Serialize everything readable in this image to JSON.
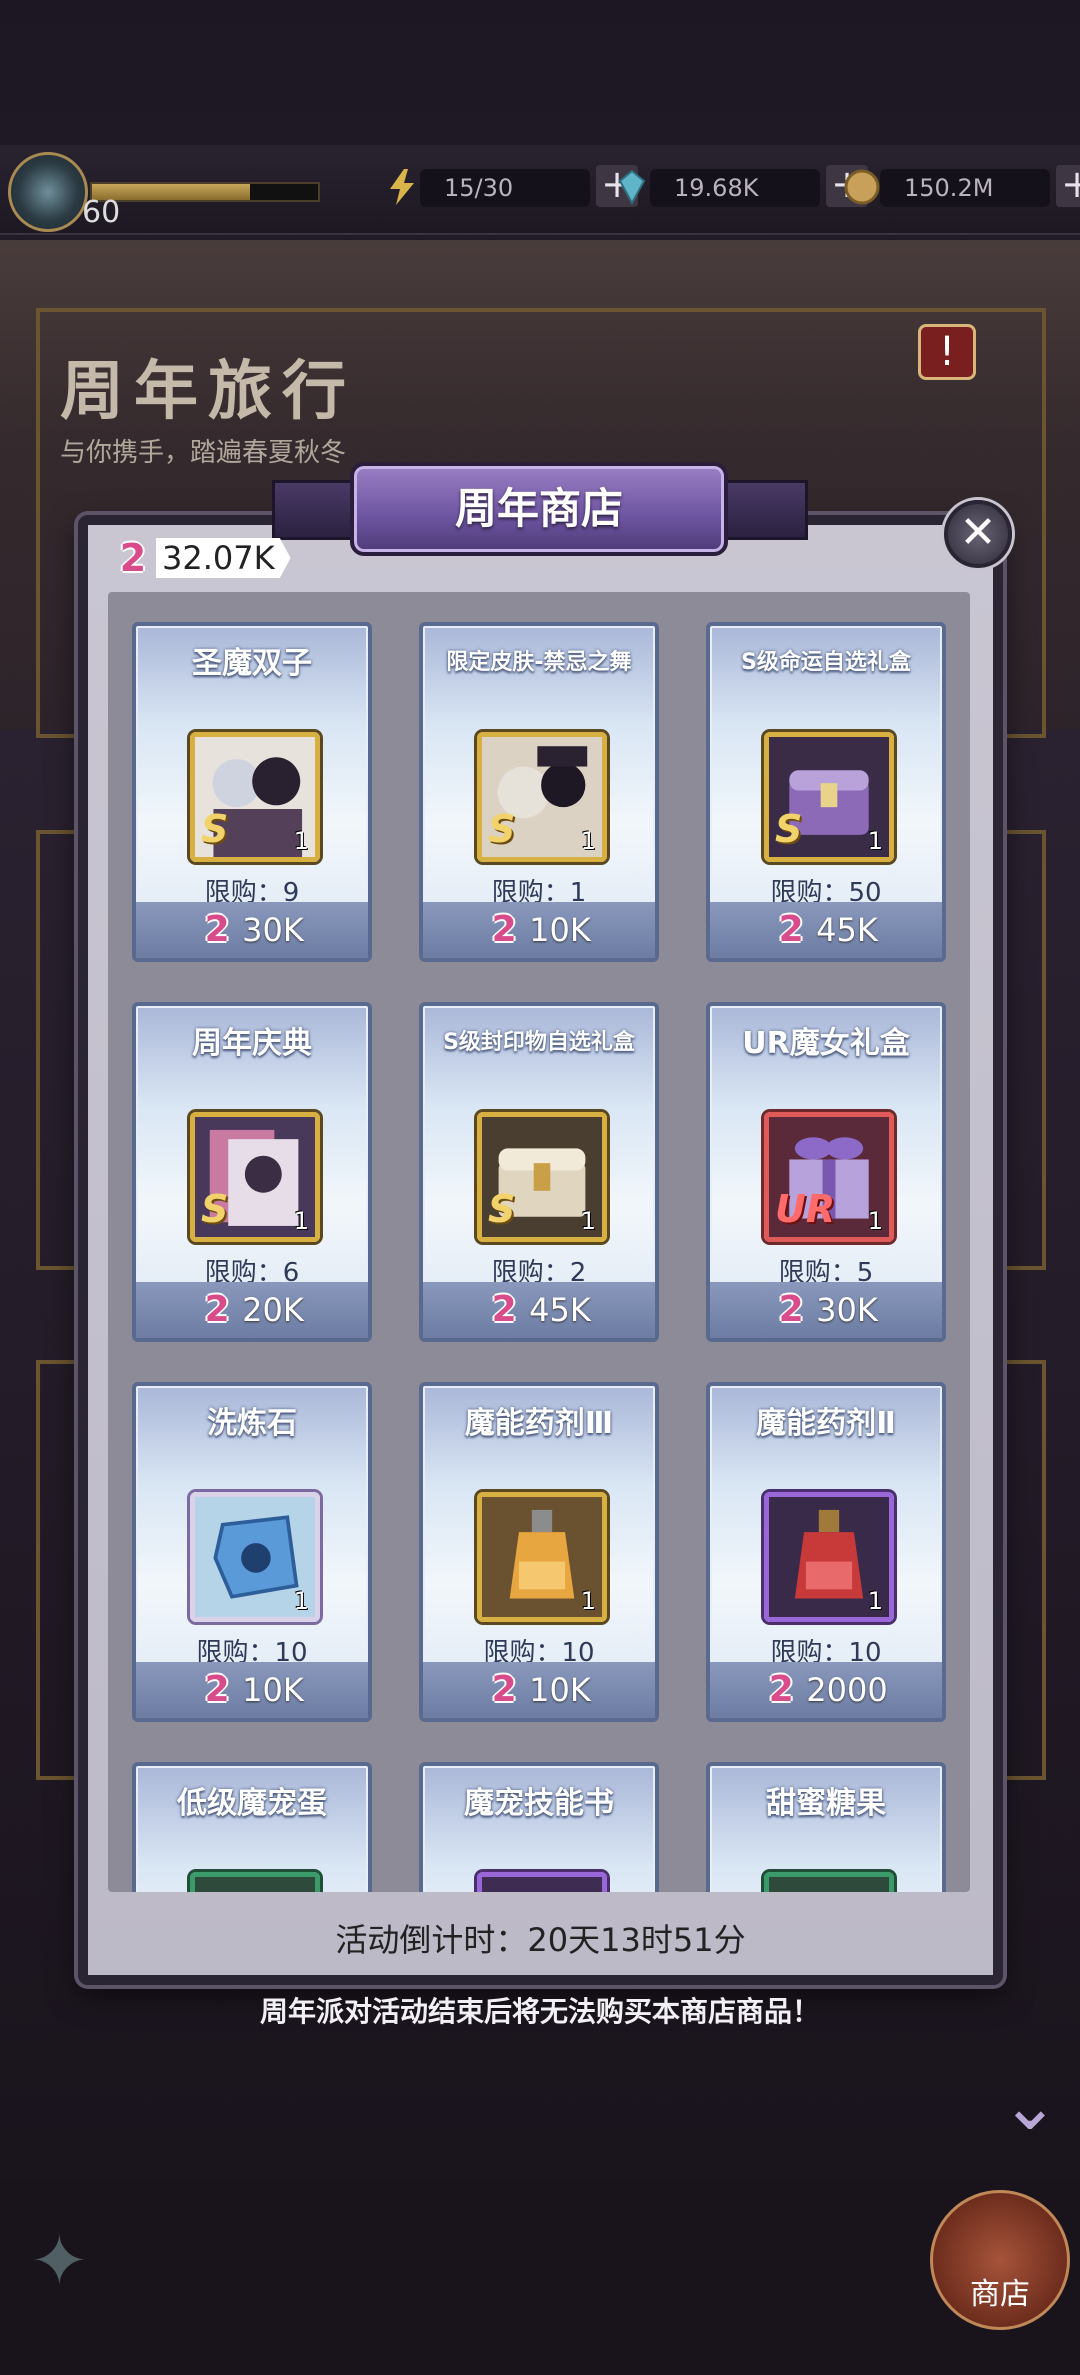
{
  "status": {
    "level": "60",
    "energy": "15/30",
    "gems": "19.68K",
    "gold": "150.2M"
  },
  "background": {
    "event_title": "周年旅行",
    "event_subtitle": "与你携手，踏遍春夏秋冬"
  },
  "modal": {
    "title": "周年商店",
    "balance": "32.07K",
    "countdown": "活动倒计时：20天13时51分"
  },
  "items": [
    {
      "name": "圣魔双子",
      "grade": "S",
      "qty": "1",
      "limit": "限购：9",
      "price": "30K"
    },
    {
      "name": "限定皮肤-禁忌之舞",
      "grade": "S",
      "qty": "1",
      "limit": "限购：1",
      "price": "10K"
    },
    {
      "name": "S级命运自选礼盒",
      "grade": "S",
      "qty": "1",
      "limit": "限购：50",
      "price": "45K"
    },
    {
      "name": "周年庆典",
      "grade": "S",
      "qty": "1",
      "limit": "限购：6",
      "price": "20K"
    },
    {
      "name": "S级封印物自选礼盒",
      "grade": "S",
      "qty": "1",
      "limit": "限购：2",
      "price": "45K"
    },
    {
      "name": "UR魔女礼盒",
      "grade": "UR",
      "qty": "1",
      "limit": "限购：5",
      "price": "30K"
    },
    {
      "name": "洗炼石",
      "grade": "",
      "qty": "1",
      "limit": "限购：10",
      "price": "10K"
    },
    {
      "name": "魔能药剂Ⅲ",
      "grade": "",
      "qty": "1",
      "limit": "限购：10",
      "price": "10K"
    },
    {
      "name": "魔能药剂Ⅱ",
      "grade": "",
      "qty": "1",
      "limit": "限购：10",
      "price": "2000"
    },
    {
      "name": "低级魔宠蛋"
    },
    {
      "name": "魔宠技能书"
    },
    {
      "name": "甜蜜糖果"
    }
  ],
  "footer": {
    "notice": "周年派对活动结束后将无法购买本商店商品！",
    "shop_label": "商店"
  },
  "currency_glyph": "2",
  "colors": {
    "accent_purple": "#6d54a0",
    "currency_pink": "#d84c8c",
    "card_blue": "#6d7ca3"
  }
}
